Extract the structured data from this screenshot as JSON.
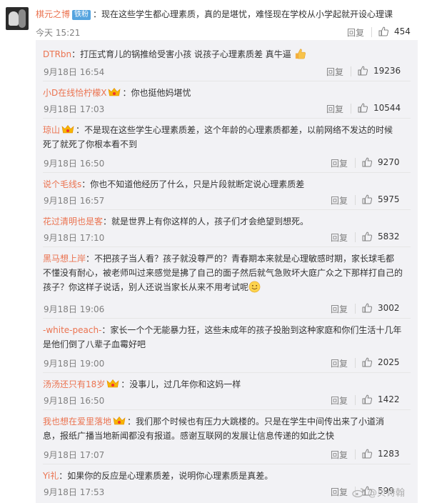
{
  "main_comment": {
    "username": "棋元之博",
    "badge": "铁粉",
    "text": "：现在这些学生都心理素质，真的是堪忧，难怪现在学校从小学起就开设心理课",
    "time": "今天 15:21",
    "reply_label": "回复",
    "likes": "454"
  },
  "replies": [
    {
      "username": "DTRbn",
      "vip": false,
      "text": "：打压式育儿的锅推给受害小孩 说孩子心理素质差 真牛逼",
      "emoji": "thumbs-up",
      "date": "9月18日 16:54",
      "reply_label": "回复",
      "likes": "19236"
    },
    {
      "username": "小D在线恰柠檬X",
      "vip": true,
      "text": "：你也挺他妈堪忧",
      "date": "9月18日 17:03",
      "reply_label": "回复",
      "likes": "10544"
    },
    {
      "username": "琼山",
      "vip": true,
      "text_line1": "：不是现在这些学生心理素质差，这个年龄的心理素质都差，以前网络不发达的时候",
      "text_line2": "死了就死了你根本看不到",
      "date": "9月18日 16:50",
      "reply_label": "回复",
      "likes": "9270"
    },
    {
      "username": "说个毛线s",
      "vip": false,
      "text": "：你也不知道他经历了什么，只是片段就断定说心理素质差",
      "date": "9月18日 16:57",
      "reply_label": "回复",
      "likes": "5975"
    },
    {
      "username": "花过清明也是客",
      "vip": false,
      "text": "：就是世界上有你这样的人，孩子们才会绝望到想死。",
      "date": "9月18日 17:10",
      "reply_label": "回复",
      "likes": "5832"
    },
    {
      "username": "黑马想上岸",
      "vip": false,
      "text_line1": "：不把孩子当人看？孩子就没尊严的？青春期本来就是心理敏感时期，家长球毛都",
      "text_line2": "不懂没有耐心，被老师叫过来感觉是拂了自己的面子然后就气急败坏大庭广众之下那样打自己的",
      "text_line3": "孩子？你这样子说话，别人还说当家长从来不用考试呢",
      "emoji": "smile",
      "date": "9月18日 19:06",
      "reply_label": "回复",
      "likes": "3002"
    },
    {
      "username": "-white-peach-",
      "vip": false,
      "text_line1": "：家长一个个无能暴力狂，这些未成年的孩子投胎到这种家庭和你们生活十几年",
      "text_line2": "是他们倒了八辈子血霉好吧",
      "date": "9月18日 19:00",
      "reply_label": "回复",
      "likes": "2025"
    },
    {
      "username": "汤汤还只有18岁",
      "vip": true,
      "text": "：没事儿，过几年你和这妈一样",
      "date": "9月18日 16:50",
      "reply_label": "回复",
      "likes": "1422"
    },
    {
      "username": "我也想在爱里落地",
      "vip": true,
      "text_line1": "：我们那个时候也有压力大跳楼的。只是在学生中间传出来了小道消",
      "text_line2": "息，报纸广播当地新闻都没有报道。感谢互联网的发展让信息传递的如此之快",
      "date": "9月18日 17:07",
      "reply_label": "回复",
      "likes": "1283"
    },
    {
      "username": "Yi礼",
      "vip": false,
      "text": "：如果你的反应是心理素质差，说明你心理素质是真差。",
      "date": "9月18日 17:53",
      "reply_label": "回复",
      "likes": "599"
    }
  ],
  "watermark": "@贝诗翰",
  "colors": {
    "username": "#eb7350",
    "badge": "#55a4df",
    "reply_bg": "#f2f2f5",
    "meta": "#808080"
  }
}
